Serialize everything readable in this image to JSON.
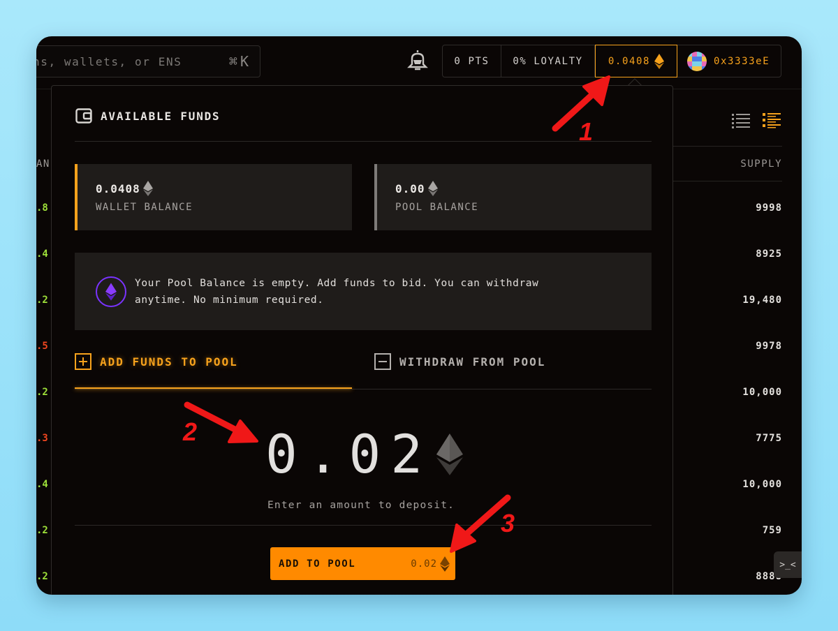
{
  "topbar": {
    "search_placeholder": "ns, wallets, or ENS",
    "search_shortcut": "⌘K",
    "points": "0 PTS",
    "loyalty": "0% LOYALTY",
    "balance": "0.0408",
    "address": "0x3333eE"
  },
  "table": {
    "left_header": "AN",
    "supply_header": "SUPPLY",
    "left_values": [
      {
        "text": ".8",
        "color": "#9ee03a"
      },
      {
        "text": ".4",
        "color": "#9ee03a"
      },
      {
        "text": ".2",
        "color": "#9ee03a"
      },
      {
        "text": ".5",
        "color": "#f0461f"
      },
      {
        "text": ".2",
        "color": "#9ee03a"
      },
      {
        "text": ".3",
        "color": "#f0461f"
      },
      {
        "text": ".4",
        "color": "#9ee03a"
      },
      {
        "text": ".2",
        "color": "#9ee03a"
      },
      {
        "text": ".2",
        "color": "#9ee03a"
      }
    ],
    "supply_values": [
      "9998",
      "8925",
      "19,480",
      "9978",
      "10,000",
      "7775",
      "10,000",
      "759",
      "8888"
    ]
  },
  "panel": {
    "title": "AVAILABLE FUNDS",
    "wallet_balance_value": "0.0408",
    "wallet_balance_label": "WALLET BALANCE",
    "pool_balance_value": "0.00",
    "pool_balance_label": "POOL BALANCE",
    "info_text": "Your Pool Balance is empty. Add funds to bid. You can withdraw anytime. No minimum required.",
    "tab_add": "ADD FUNDS TO POOL",
    "tab_withdraw": "WITHDRAW FROM POOL",
    "amount": "0.02",
    "amount_hint": "Enter an amount to deposit.",
    "button_label": "ADD TO POOL",
    "button_amount": "0.02"
  },
  "annotations": {
    "n1": "1",
    "n2": "2",
    "n3": "3"
  },
  "colors": {
    "accent": "#f7a21c",
    "button": "#ff8a00",
    "annotation": "#f01818",
    "eth_purple": "#7a33ff"
  }
}
